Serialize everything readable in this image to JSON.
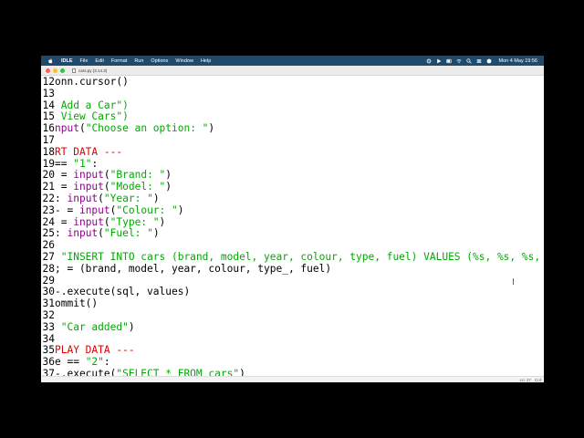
{
  "menubar": {
    "app_name": "IDLE",
    "items": [
      "File",
      "Edit",
      "Format",
      "Run",
      "Options",
      "Window",
      "Help"
    ],
    "clock": "Mon 4 May  19:56",
    "status_icons": [
      "gear-icon",
      "play-icon",
      "battery-icon",
      "wifi-icon",
      "search-icon",
      "control-center-icon",
      "siri-icon"
    ]
  },
  "window": {
    "title": "cars.py (3.14.3)"
  },
  "editor": {
    "lines": [
      {
        "n": "12",
        "segs": [
          {
            "t": "onn.cursor()",
            "c": "plain"
          }
        ]
      },
      {
        "n": "13",
        "segs": []
      },
      {
        "n": "14",
        "segs": [
          {
            "t": " Add a Car\")",
            "c": "str"
          }
        ]
      },
      {
        "n": "15",
        "segs": [
          {
            "t": " View Cars\")",
            "c": "str"
          }
        ]
      },
      {
        "n": "16",
        "segs": [
          {
            "t": "nput",
            "c": "bi"
          },
          {
            "t": "(",
            "c": "plain"
          },
          {
            "t": "\"Choose an option: \"",
            "c": "str"
          },
          {
            "t": ")",
            "c": "plain"
          }
        ]
      },
      {
        "n": "17",
        "segs": []
      },
      {
        "n": "18",
        "segs": [
          {
            "t": "RT DATA ---",
            "c": "cm"
          }
        ]
      },
      {
        "n": "19",
        "segs": [
          {
            "t": "== ",
            "c": "plain"
          },
          {
            "t": "\"1\"",
            "c": "str"
          },
          {
            "t": ":",
            "c": "plain"
          }
        ]
      },
      {
        "n": "20",
        "segs": [
          {
            "t": " = ",
            "c": "plain"
          },
          {
            "t": "input",
            "c": "bi"
          },
          {
            "t": "(",
            "c": "plain"
          },
          {
            "t": "\"Brand: \"",
            "c": "str"
          },
          {
            "t": ")",
            "c": "plain"
          }
        ]
      },
      {
        "n": "21",
        "segs": [
          {
            "t": " = ",
            "c": "plain"
          },
          {
            "t": "input",
            "c": "bi"
          },
          {
            "t": "(",
            "c": "plain"
          },
          {
            "t": "\"Model: \"",
            "c": "str"
          },
          {
            "t": ")",
            "c": "plain"
          }
        ]
      },
      {
        "n": "22",
        "segs": [
          {
            "t": ": ",
            "c": "plain"
          },
          {
            "t": "input",
            "c": "bi"
          },
          {
            "t": "(",
            "c": "plain"
          },
          {
            "t": "\"Year: \"",
            "c": "str"
          },
          {
            "t": ")",
            "c": "plain"
          }
        ]
      },
      {
        "n": "23",
        "segs": [
          {
            "t": "- = ",
            "c": "plain"
          },
          {
            "t": "input",
            "c": "bi"
          },
          {
            "t": "(",
            "c": "plain"
          },
          {
            "t": "\"Colour: \"",
            "c": "str"
          },
          {
            "t": ")",
            "c": "plain"
          }
        ]
      },
      {
        "n": "24",
        "segs": [
          {
            "t": " = ",
            "c": "plain"
          },
          {
            "t": "input",
            "c": "bi"
          },
          {
            "t": "(",
            "c": "plain"
          },
          {
            "t": "\"Type: \"",
            "c": "str"
          },
          {
            "t": ")",
            "c": "plain"
          }
        ]
      },
      {
        "n": "25",
        "segs": [
          {
            "t": ": ",
            "c": "plain"
          },
          {
            "t": "input",
            "c": "bi"
          },
          {
            "t": "(",
            "c": "plain"
          },
          {
            "t": "\"Fuel: \"",
            "c": "str"
          },
          {
            "t": ")",
            "c": "plain"
          }
        ]
      },
      {
        "n": "26",
        "segs": []
      },
      {
        "n": "27",
        "segs": [
          {
            "t": " \"INSERT INTO cars (brand, model, year, colour, type, fuel) VALUES (%s, %s, %s, %s",
            "c": "str"
          }
        ]
      },
      {
        "n": "28",
        "segs": [
          {
            "t": "; = (brand, model, year, colour, type_, fuel)",
            "c": "plain"
          }
        ]
      },
      {
        "n": "29",
        "segs": []
      },
      {
        "n": "30",
        "segs": [
          {
            "t": "-.execute(sql, values)",
            "c": "plain"
          }
        ]
      },
      {
        "n": "31",
        "segs": [
          {
            "t": "ommit()",
            "c": "plain"
          }
        ]
      },
      {
        "n": "32",
        "segs": []
      },
      {
        "n": "33",
        "segs": [
          {
            "t": " ",
            "c": "plain"
          },
          {
            "t": "\"Car added\"",
            "c": "str"
          },
          {
            "t": ")",
            "c": "plain"
          }
        ]
      },
      {
        "n": "34",
        "segs": []
      },
      {
        "n": "35",
        "segs": [
          {
            "t": "PLAY DATA ---",
            "c": "cm"
          }
        ]
      },
      {
        "n": "36",
        "segs": [
          {
            "t": "e == ",
            "c": "plain"
          },
          {
            "t": "\"2\"",
            "c": "str"
          },
          {
            "t": ":",
            "c": "plain"
          }
        ]
      },
      {
        "n": "37",
        "segs": [
          {
            "t": "-.execute(",
            "c": "plain"
          },
          {
            "t": "\"SELECT * FROM cars\"",
            "c": "str"
          },
          {
            "t": ")",
            "c": "plain"
          }
        ]
      }
    ]
  },
  "statusbar": {
    "line": "Ln: 27",
    "col": "Col:"
  },
  "colors": {
    "menubar_bg": "#1f4a6b",
    "string": "#00aa00",
    "builtin": "#900090",
    "comment": "#dd0000",
    "keyword": "#ff7700"
  }
}
